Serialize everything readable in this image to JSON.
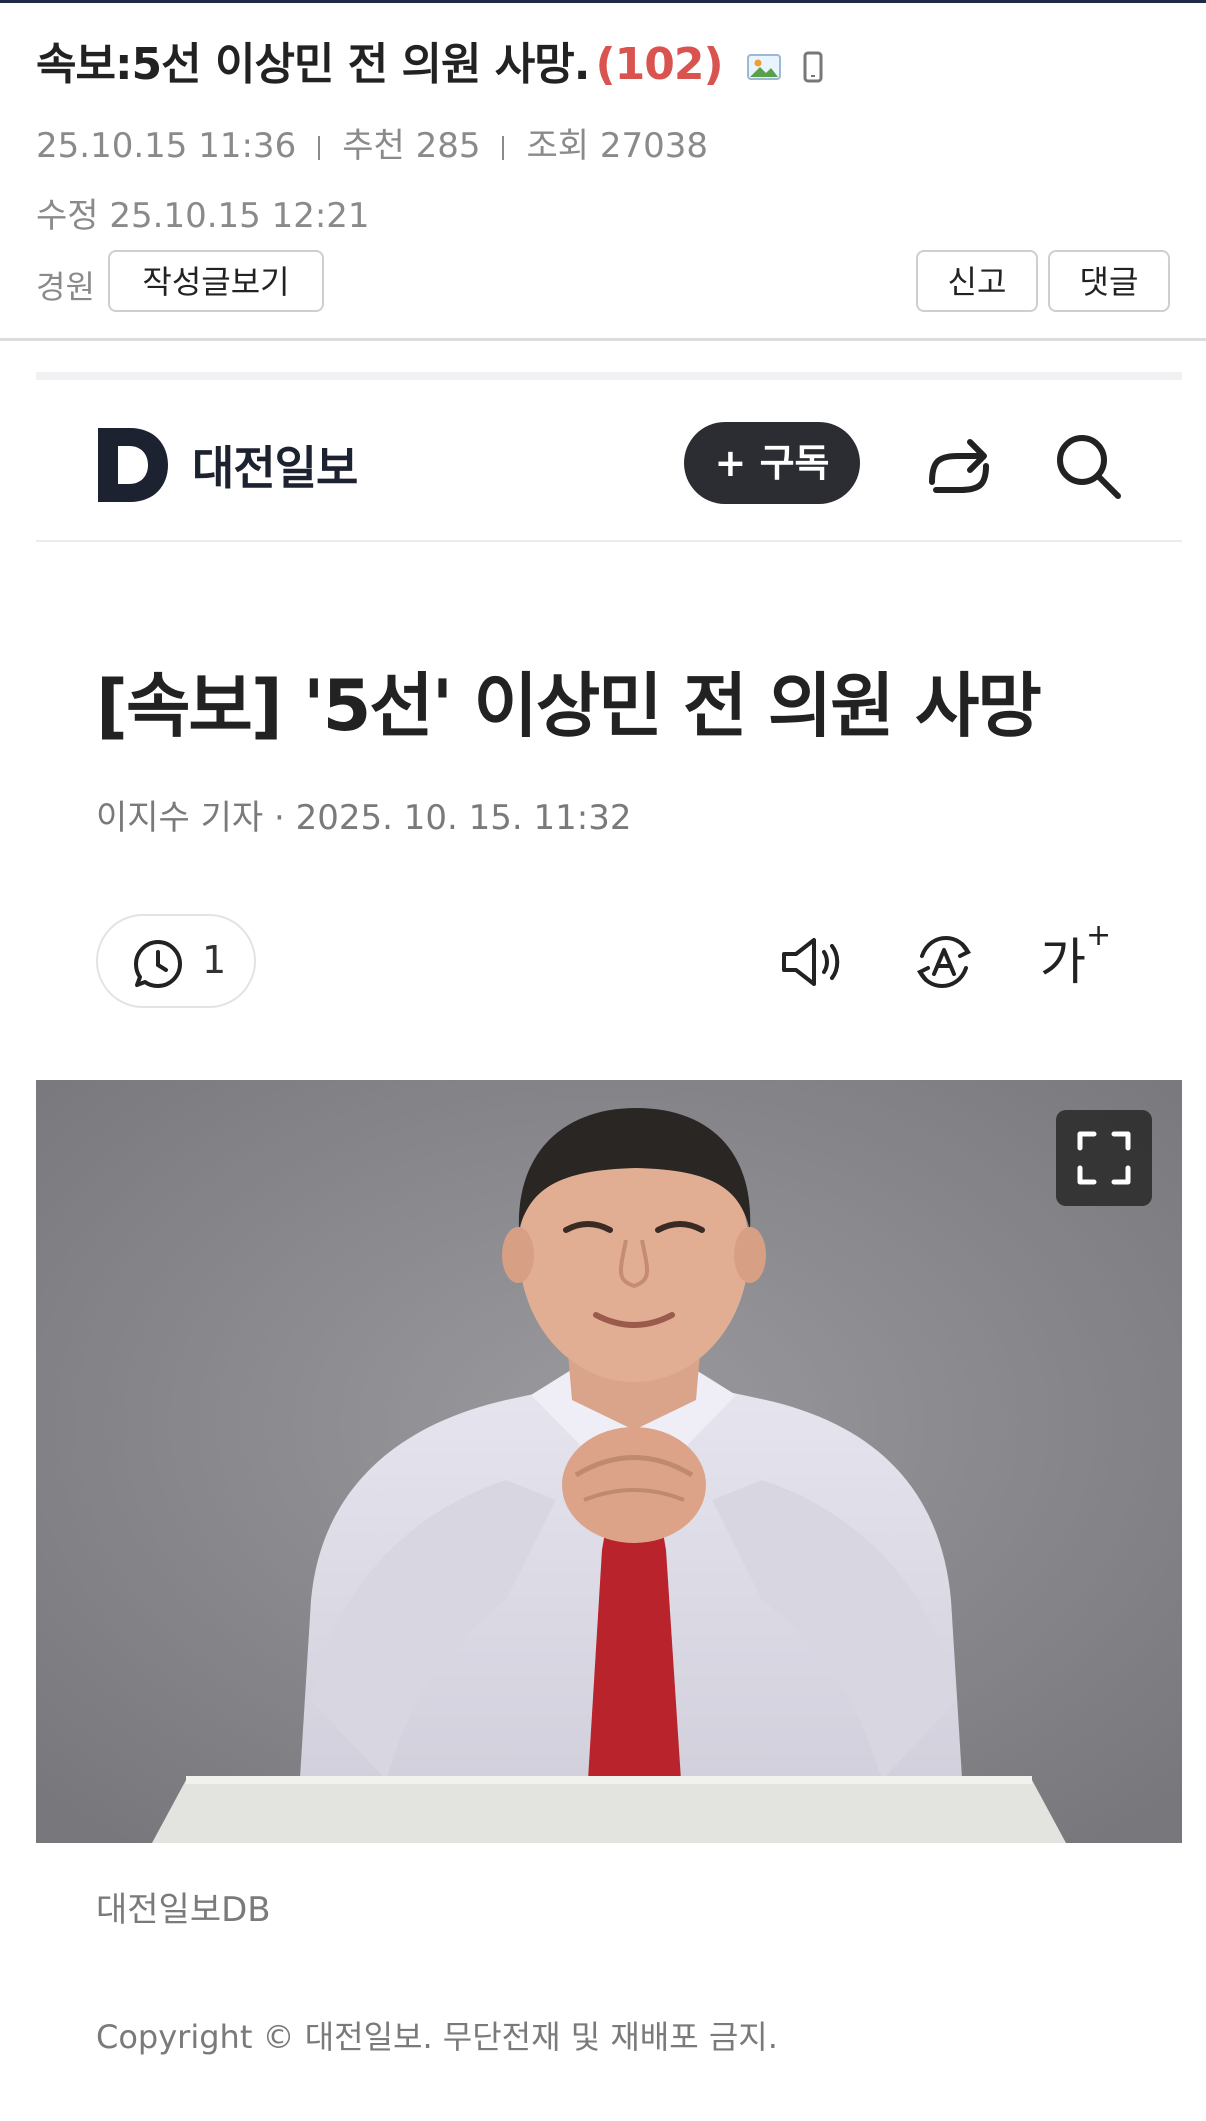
{
  "post": {
    "title": "속보:5선 이상민 전 의원 사망.",
    "comment_count": "(102)",
    "date": "25.10.15  11:36",
    "recommend": "추천 285",
    "views": "조회 27038",
    "modified": "수정 25.10.15  12:21",
    "author": "경원",
    "view_posts_label": "작성글보기",
    "report_label": "신고",
    "comment_label": "댓글",
    "title_icons": [
      "image-icon",
      "mobile-icon"
    ]
  },
  "news": {
    "logo_text": "대전일보",
    "subscribe_label": "+ 구독",
    "headline": "[속보] '5선' 이상민 전 의원 사망",
    "byline": "이지수 기자 ·  2025. 10. 15. 11:32",
    "comment_count": "1",
    "tool_icons": [
      "comment-clock-icon",
      "speaker-icon",
      "translate-icon",
      "font-size-icon"
    ],
    "font_size_label": "가",
    "photo_caption": "대전일보DB",
    "copyright": "Copyright © 대전일보. 무단전재 및 재배포 금지."
  },
  "colors": {
    "accent_red": "#d9534f",
    "subscribe_bg": "#2b2d33",
    "logo_navy": "#1d2230"
  }
}
